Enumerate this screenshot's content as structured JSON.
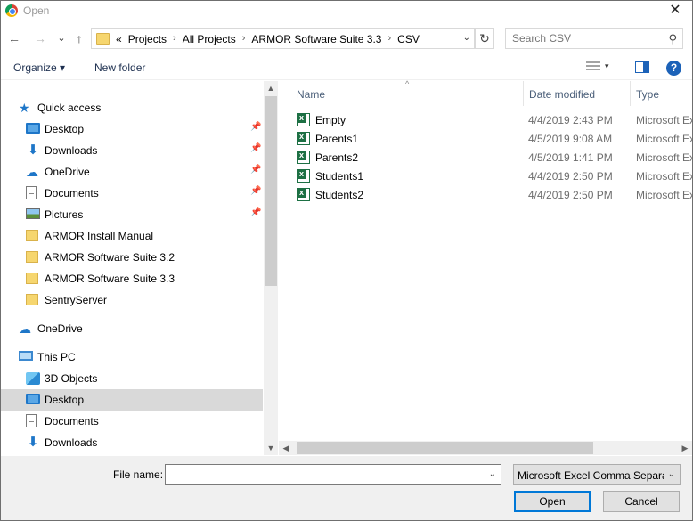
{
  "window": {
    "title": "Open",
    "close_glyph": "✕"
  },
  "nav": {
    "back_glyph": "←",
    "forward_glyph": "→",
    "recent_glyph": "⌄",
    "up_glyph": "↑",
    "breadcrumb_prefix": "«",
    "breadcrumbs": [
      "Projects",
      "All Projects",
      "ARMOR Software Suite 3.3",
      "CSV"
    ],
    "separator": "›",
    "refresh_glyph": "↻",
    "search_placeholder": "Search CSV",
    "search_glyph": "⚲"
  },
  "toolbar": {
    "organize_label": "Organize ▾",
    "new_folder_label": "New folder",
    "view_caret": "▾",
    "help_label": "?"
  },
  "sidebar": {
    "items": [
      {
        "label": "Quick access",
        "icon": "star-icon",
        "level": 0,
        "pinned": false
      },
      {
        "label": "Desktop",
        "icon": "desktop-icon",
        "level": 1,
        "pinned": true
      },
      {
        "label": "Downloads",
        "icon": "download-icon",
        "level": 1,
        "pinned": true
      },
      {
        "label": "OneDrive",
        "icon": "onedrive-icon",
        "level": 1,
        "pinned": true
      },
      {
        "label": "Documents",
        "icon": "documents-icon",
        "level": 1,
        "pinned": true
      },
      {
        "label": "Pictures",
        "icon": "pictures-icon",
        "level": 1,
        "pinned": true
      },
      {
        "label": "ARMOR Install Manual",
        "icon": "folder-icon",
        "level": 1,
        "pinned": false
      },
      {
        "label": "ARMOR Software Suite 3.2",
        "icon": "folder-icon",
        "level": 1,
        "pinned": false
      },
      {
        "label": "ARMOR Software Suite 3.3",
        "icon": "folder-icon",
        "level": 1,
        "pinned": false
      },
      {
        "label": "SentryServer",
        "icon": "folder-icon",
        "level": 1,
        "pinned": false
      },
      {
        "label": "OneDrive",
        "icon": "onedrive-icon",
        "level": 0,
        "pinned": false
      },
      {
        "label": "This PC",
        "icon": "this-pc-icon",
        "level": 0,
        "pinned": false
      },
      {
        "label": "3D Objects",
        "icon": "3d-objects-icon",
        "level": 1,
        "pinned": false
      },
      {
        "label": "Desktop",
        "icon": "desktop-icon",
        "level": 1,
        "pinned": false,
        "selected": true
      },
      {
        "label": "Documents",
        "icon": "documents-icon",
        "level": 1,
        "pinned": false
      },
      {
        "label": "Downloads",
        "icon": "download-icon",
        "level": 1,
        "pinned": false
      }
    ],
    "pin_glyph": "📌"
  },
  "filelist": {
    "columns": {
      "name": "Name",
      "date": "Date modified",
      "type": "Type"
    },
    "sort_glyph": "^",
    "files": [
      {
        "name": "Empty",
        "date": "4/4/2019 2:43 PM",
        "type": "Microsoft Excel Comma Separated Values File"
      },
      {
        "name": "Parents1",
        "date": "4/5/2019 9:08 AM",
        "type": "Microsoft Excel Comma Separated Values File"
      },
      {
        "name": "Parents2",
        "date": "4/5/2019 1:41 PM",
        "type": "Microsoft Excel Comma Separated Values File"
      },
      {
        "name": "Students1",
        "date": "4/4/2019 2:50 PM",
        "type": "Microsoft Excel Comma Separated Values File"
      },
      {
        "name": "Students2",
        "date": "4/4/2019 2:50 PM",
        "type": "Microsoft Excel Comma Separated Values File"
      }
    ]
  },
  "scroll": {
    "up": "▲",
    "down": "▼",
    "left": "◀",
    "right": "▶"
  },
  "footer": {
    "file_name_label": "File name:",
    "file_name_value": "",
    "file_type_value": "Microsoft Excel Comma Separated Values File",
    "dropdown_glyph": "⌄",
    "open_label": "Open",
    "cancel_label": "Cancel"
  }
}
